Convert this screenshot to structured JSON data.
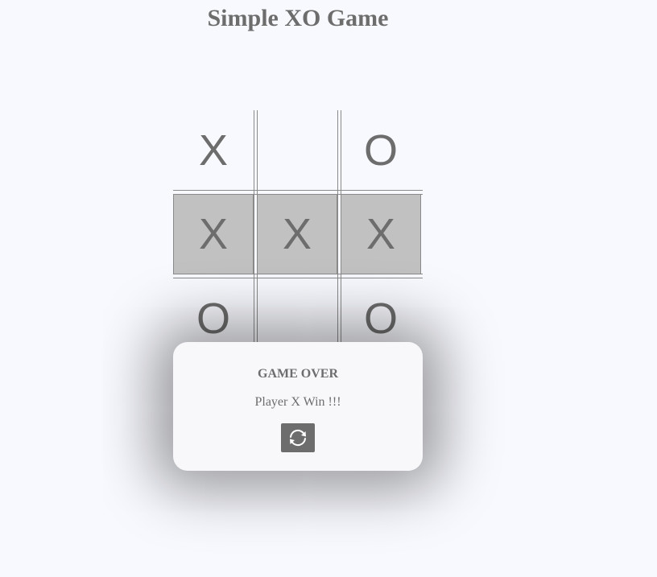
{
  "title": "Simple XO Game",
  "board": {
    "cells": [
      "X",
      "",
      "O",
      "X",
      "X",
      "X",
      "O",
      "",
      "O"
    ],
    "winning_cells": [
      3,
      4,
      5
    ],
    "highlight_color": "#c1c1c1",
    "mark_color": "#6d6d6d"
  },
  "modal": {
    "title": "GAME OVER",
    "message": "Player X Win !!!",
    "restart_icon": "refresh-icon"
  }
}
